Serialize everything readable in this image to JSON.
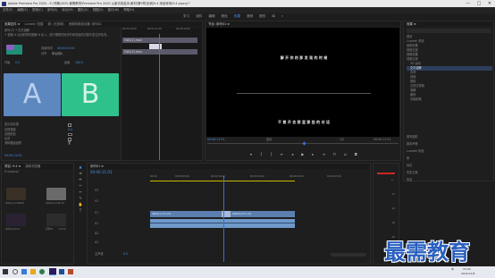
{
  "titlebar": {
    "title": "Adobe Premiere Pro 2020 - E:\\书籍\\2020 最需教育\\Premiere Pro 2020 从新手到高手\\素材\\第9章\\实例\\9.4 添加转场\\9.4.prproj *",
    "minimize": "—",
    "maximize": "□",
    "close": "✕"
  },
  "menubar": [
    "文件(F)",
    "编辑(E)",
    "剪辑(C)",
    "序列(S)",
    "标记(M)",
    "图形(G)",
    "视图(V)",
    "窗口(W)",
    "帮助(H)"
  ],
  "workspaces": {
    "items": [
      "学习",
      "组件",
      "编辑",
      "颜色",
      "效果",
      "音频",
      "图形",
      "库"
    ],
    "active": "效果",
    "more": "»"
  },
  "effect_controls": {
    "tabs": [
      "效果控件 ≡",
      "Lumetri 范围",
      "源: (无剪辑)",
      "音频剪辑混合器: 序列01"
    ],
    "clip_path": "序列 01 * 交叉溶解",
    "desc": "↑ 图像 A 淡出的同时图像 B 淡入，用于展现在较长时间流逝的过程中发生的情况。",
    "duration_label": "持续时间",
    "duration_value": "00:00:01:00",
    "align_label": "对齐",
    "align_value": "中心切入",
    "start_label": "开始",
    "start_value": "0.0",
    "end_label": "结束",
    "end_value": "100.0",
    "a_label": "A",
    "b_label": "B",
    "show_actual_sources": "显示实际源",
    "border_width": "边框宽度",
    "border_width_value": "0.0",
    "border_color": "边框颜色",
    "reverse": "反向",
    "antialias": "消除锯齿品质",
    "antialias_value": "关",
    "timecode": "00:00:11:01",
    "ruler": [
      "00:00:10:00",
      "00:00:11:00",
      "00:00:12:00"
    ],
    "clip_a": "GWL(1).mov",
    "clip_b": "GWL(2).mov",
    "transition": "交叉溶解"
  },
  "program_monitor": {
    "tab": "节目: 序列01 ≡",
    "subtitle_top": "解 开 你 的 那 发 现 的 时 候",
    "subtitle_bottom": "不 曾 开 会 那 里 那 些 的 对 话",
    "timecode_left": "00:00:11:01",
    "fit": "适合",
    "ratio": "1/2",
    "timecode_right": "00:00:11:21"
  },
  "effects_panel": {
    "tab": "效果 ≡",
    "search_placeholder": "",
    "items": [
      "预设",
      "Lumetri 预设",
      "音频效果",
      "音频过渡",
      "视频效果",
      "视频过渡",
      "3D 运动",
      "内滑",
      "划像",
      "擦除",
      "沉浸式视频",
      "溶解",
      "缩放",
      "页面剥落"
    ],
    "selected": "交叉溶解",
    "sections": [
      "基本图形",
      "基本声音",
      "Lumetri 颜色",
      "库",
      "标记",
      "历史记录",
      "信息"
    ]
  },
  "project_panel": {
    "tab": "项目: 9.4 ≡",
    "media_browser": "媒体浏览器",
    "path": "9.4.prproj",
    "items": [
      {
        "name": "GWL(1).mov",
        "dur": "5:00"
      },
      {
        "name": "GWL(2).mov",
        "dur": "7:10"
      },
      {
        "name": "GWL(3).mov",
        "dur": ""
      },
      {
        "name": "序列01",
        "dur": "13:10"
      }
    ]
  },
  "timeline": {
    "tab": "序列01 ≡",
    "timecode": "00:00:11:01",
    "ruler": [
      "00:00",
      "00:00:05:00",
      "00:00:10:00",
      "00:00:15:00",
      "00:00:20:00",
      "00:00:25:00"
    ],
    "tracks": [
      {
        "id": "V3",
        "label": "V3"
      },
      {
        "id": "V2",
        "label": "V2"
      },
      {
        "id": "V1",
        "label": "V1"
      },
      {
        "id": "A1",
        "label": "A1"
      },
      {
        "id": "A2",
        "label": "A2"
      },
      {
        "id": "A3",
        "label": "A3"
      }
    ],
    "master": "主声道",
    "master_value": "0.0",
    "clips": {
      "v1_a": "GWL(1).mov [V]",
      "v1_b": "GWL(2).mov [V]"
    },
    "vu_labels": [
      "0",
      "-12",
      "-24",
      "-36",
      "-48",
      "dB"
    ]
  },
  "watermark": "最需教育",
  "taskbar": {
    "time": "15:00",
    "date": "2021/11/8",
    "lang": "中"
  },
  "colors": {
    "accent": "#4a90e2",
    "clip_a": "#5d87bf",
    "clip_b": "#2fc18b",
    "video_clip": "#5b7fb0",
    "audio_clip": "#6f99c8",
    "playhead": "#3b6fd6"
  }
}
